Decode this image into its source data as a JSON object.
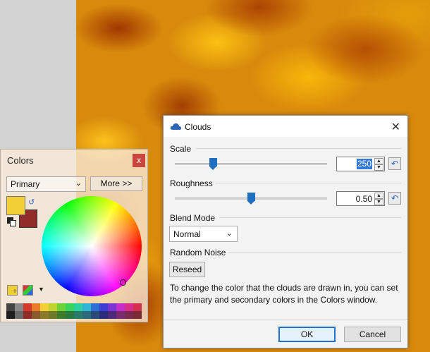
{
  "colors_window": {
    "title": "Colors",
    "close_icon": "close-icon",
    "mode_select": "Primary",
    "more_button": "More >>",
    "primary_color": "#f2cf35",
    "secondary_color": "#8e2d2a",
    "palette": [
      "#444444",
      "#888888",
      "#d23b2c",
      "#e87c2b",
      "#f2cf35",
      "#c2d32f",
      "#6dd23a",
      "#38d45c",
      "#2dd0a0",
      "#2fb4d4",
      "#2f6fd4",
      "#3b3fd2",
      "#7a35d2",
      "#c22fc8",
      "#d62f8a",
      "#d42f4c",
      "#1e1e1e",
      "#6a6a6a",
      "#8e2d2a",
      "#8a5a2a",
      "#8a7a2a",
      "#6e7a2a",
      "#3d7a2a",
      "#2a7a40",
      "#2a7a6a",
      "#2a6a7a",
      "#2a4a7a",
      "#2a2e7a",
      "#4e2a7a",
      "#7a2a6e",
      "#7a2a4e",
      "#7a2a32"
    ]
  },
  "clouds_dialog": {
    "title": "Clouds",
    "close_icon": "close-icon",
    "scale": {
      "label": "Scale",
      "value": "250",
      "slider_fraction": 0.25
    },
    "roughness": {
      "label": "Roughness",
      "value": "0.50",
      "slider_fraction": 0.5
    },
    "blend_mode": {
      "label": "Blend Mode",
      "selected": "Normal"
    },
    "random_noise": {
      "label": "Random Noise",
      "reseed_button": "Reseed"
    },
    "help_text": "To change the color that the clouds are drawn in, you can set the primary and secondary colors in the Colors window.",
    "ok_button": "OK",
    "cancel_button": "Cancel"
  }
}
